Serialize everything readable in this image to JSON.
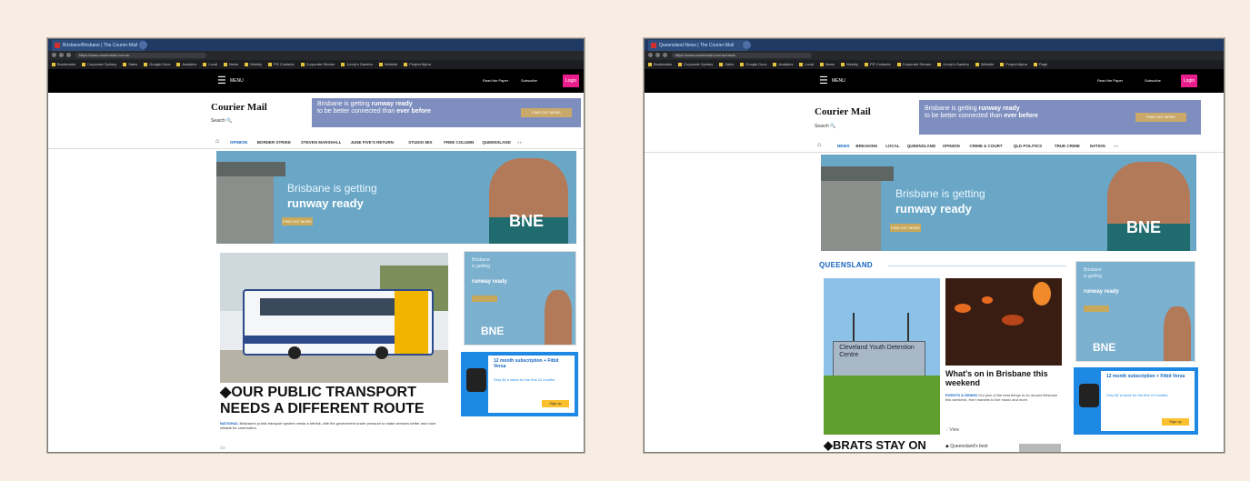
{
  "left": {
    "browser": {
      "active_tab": "Brisbane/Brisbane | The Courier-Mail",
      "url": "https://www.couriermail.com.au",
      "bookmarks": [
        "Bookmarks",
        "Corporate Sydney",
        "Sales",
        "Google Docs",
        "Analytics",
        "Local",
        "News",
        "Weekly",
        "PR Contacts",
        "Corporate Stream",
        "Jonny's Gazebo",
        "Website",
        "Project Alpha"
      ]
    },
    "site": {
      "menu_label": "MENU",
      "masthead": "Courier Mail",
      "search_label": "Search",
      "top_links": [
        "Read the Paper",
        "Subscribe"
      ],
      "login_label": "Login",
      "top_ad": {
        "line1": "Brisbane is getting",
        "bold1": "runway ready",
        "line2": "to be better connected than",
        "bold2": "ever before",
        "button": "FIND OUT MORE"
      },
      "nav": [
        "OPINION",
        "BORDER STRIKE",
        "STEVEN MARSHALL",
        "JUNE FIVE'S RETURN",
        "STUDIO MIX",
        "FREE COLUMN",
        "QUEENSLAND"
      ],
      "banner": {
        "line1": "Brisbane is getting",
        "line2": "runway ready",
        "button": "FIND OUT MORE",
        "logo": "BNE"
      },
      "side_ad": {
        "line1": "Brisbane",
        "line2": "is getting",
        "line3": "runway ready",
        "logo": "BNE"
      },
      "fitbit_ad": {
        "heading": "12 month subscription + Fitbit Versa",
        "sub": "Only $2 a week for the first 12 months",
        "button": "Sign up"
      },
      "story": {
        "headline": "OUR PUBLIC TRANSPORT NEEDS A DIFFERENT ROUTE",
        "category": "NATIONAL",
        "excerpt": "Brisbane's public transport system needs a rethink, with the government under pressure to make services better and more reliable for commuters."
      }
    }
  },
  "right": {
    "browser": {
      "active_tab": "Queensland News | The Courier-Mail",
      "url": "https://www.couriermail.com.au/news",
      "bookmarks": [
        "Bookmarks",
        "Corporate Sydney",
        "Sales",
        "Google Docs",
        "Analytics",
        "Local",
        "News",
        "Weekly",
        "PR Contacts",
        "Corporate Stream",
        "Jonny's Gazebo",
        "Website",
        "Project Alpha",
        "Page"
      ]
    },
    "site": {
      "menu_label": "MENU",
      "masthead": "Courier Mail",
      "search_label": "Search",
      "top_links": [
        "Read the Paper",
        "Subscribe"
      ],
      "login_label": "Login",
      "top_ad": {
        "line1": "Brisbane is getting",
        "bold1": "runway ready",
        "line2": "to be better connected than",
        "bold2": "ever before",
        "button": "FIND OUT MORE"
      },
      "nav": [
        "NEWS",
        "BREAKING",
        "LOCAL",
        "QUEENSLAND",
        "OPINION",
        "CRIME & COURT",
        "QLD POLITICS",
        "TRUE CRIME",
        "NATION"
      ],
      "banner": {
        "line1": "Brisbane is getting",
        "line2": "runway ready",
        "button": "FIND OUT MORE",
        "logo": "BNE"
      },
      "section_header": "QUEENSLAND",
      "card1": {
        "sign": "Cleveland Youth Detention Centre",
        "headline": "BRATS STAY ON"
      },
      "card2": {
        "headline": "What's on in Brisbane this weekend",
        "category": "EVENTS & DINING",
        "excerpt": "Our pick of the best things to do around Brisbane this weekend, from markets to live music and more.",
        "comments": "View"
      },
      "side_ad": {
        "line1": "Brisbane",
        "line2": "is getting",
        "line3": "runway ready",
        "logo": "BNE"
      },
      "fitbit_ad": {
        "heading": "12 month subscription + Fitbit Versa",
        "sub": "Only $2 a week for the first 12 months",
        "button": "Sign up"
      },
      "footer_snippet": "Queensland's best"
    }
  }
}
